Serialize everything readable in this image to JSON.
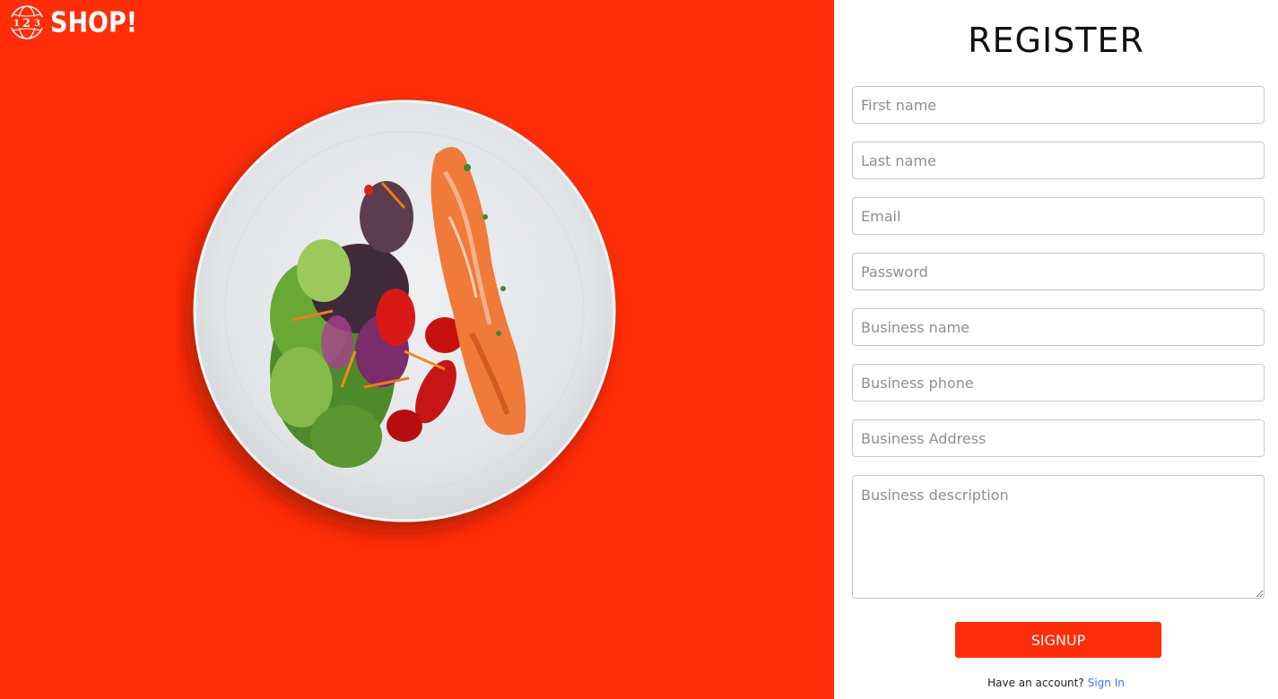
{
  "brand": {
    "logo_digits": [
      "1",
      "2",
      "3"
    ],
    "name": "SHOP!"
  },
  "register": {
    "title": "REGISTER",
    "fields": {
      "first_name": "First name",
      "last_name": "Last name",
      "email": "Email",
      "password": "Password",
      "business_name": "Business name",
      "business_phone": "Business phone",
      "business_address": "Business Address",
      "business_description": "Business description"
    },
    "signup_label": "SIGNUP",
    "have_account_text": "Have an account?",
    "sign_in_label": "Sign In"
  },
  "colors": {
    "accent": "#ff2d08",
    "link": "#2b7be4"
  },
  "hero_image": {
    "icon": "salmon-salad-plate"
  }
}
